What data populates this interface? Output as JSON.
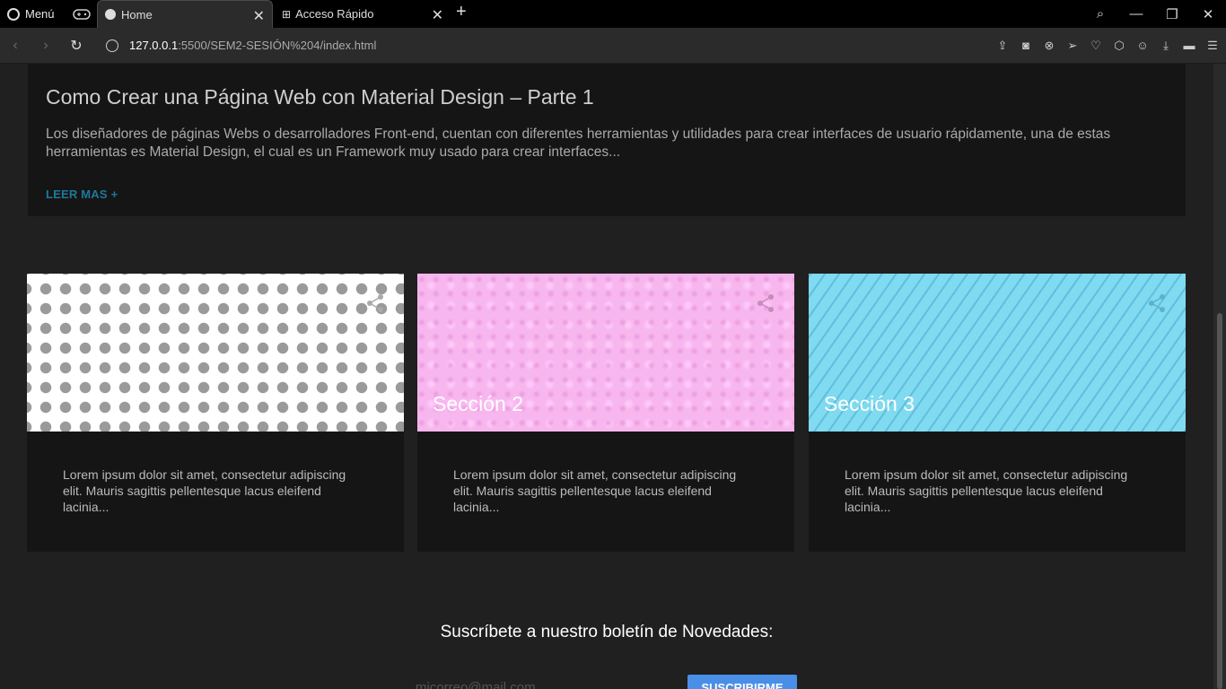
{
  "browser": {
    "menu_label": "Menú",
    "tabs": [
      {
        "title": "Home",
        "active": true
      },
      {
        "title": "Acceso Rápido",
        "active": false
      }
    ],
    "url_host": "127.0.0.1",
    "url_rest": ":5500/SEM2-SESIÓN%204/index.html"
  },
  "article": {
    "title": "Como Crear una Página Web con Material Design – Parte 1",
    "excerpt": "Los diseñadores de páginas Webs o desarrolladores Front-end, cuentan con diferentes herramientas y utilidades para crear interfaces de usuario rápidamente, una de estas herramientas es Material Design, el cual es un Framework muy usado para crear interfaces...",
    "read_more": "LEER MAS +"
  },
  "cards": [
    {
      "title": "",
      "text": "Lorem ipsum dolor sit amet, consectetur adipiscing elit. Mauris sagittis pellentesque lacus eleifend lacinia..."
    },
    {
      "title": "Sección 2",
      "text": "Lorem ipsum dolor sit amet, consectetur adipiscing elit. Mauris sagittis pellentesque lacus eleifend lacinia..."
    },
    {
      "title": "Sección 3",
      "text": "Lorem ipsum dolor sit amet, consectetur adipiscing elit. Mauris sagittis pellentesque lacus eleifend lacinia..."
    }
  ],
  "newsletter": {
    "heading": "Suscríbete a nuestro boletín de Novedades:",
    "email_placeholder": "micorreo@mail.com",
    "button": "SUSCRIBIRME"
  },
  "colors": {
    "link": "#1d7a9a",
    "button": "#4a8fe7"
  }
}
